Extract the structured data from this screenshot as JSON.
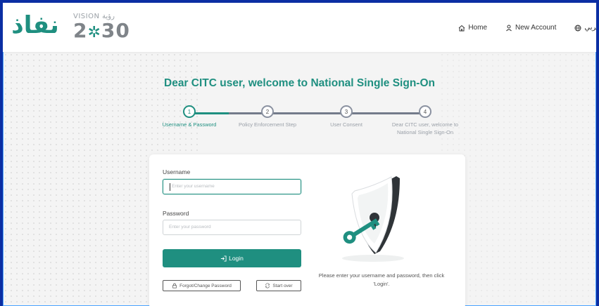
{
  "header": {
    "logo_text": "نفاذ",
    "vision_label": "VISION رؤية",
    "vision_year_left": "2",
    "vision_year_right": "30",
    "nav": {
      "home": "Home",
      "new_account": "New Account",
      "language": "عربي"
    }
  },
  "main": {
    "title": "Dear CITC user, welcome to National Single Sign-On",
    "steps": [
      {
        "number": "1",
        "label": "Username & Password"
      },
      {
        "number": "2",
        "label": "Policy Enforcement Step"
      },
      {
        "number": "3",
        "label": "User Consent"
      },
      {
        "number": "4",
        "label": "Dear CITC user, welcome to National Single Sign-On"
      }
    ],
    "current_step": 1
  },
  "form": {
    "username_label": "Username",
    "username_placeholder": "Enter your username",
    "password_label": "Password",
    "password_placeholder": "Enter your password",
    "login_label": "Login",
    "forgot_label": "Forgot/Change Password",
    "start_over_label": "Start over",
    "help_text": "Please enter your username and password, then click 'Login'."
  },
  "colors": {
    "brand": "#1f8f80",
    "outer_border": "#0b2ea3"
  },
  "icons": {
    "home": "home-icon",
    "new_account": "user-icon",
    "language": "globe-icon",
    "login": "sign-in-icon",
    "forgot": "lock-icon",
    "start_over": "refresh-icon"
  }
}
